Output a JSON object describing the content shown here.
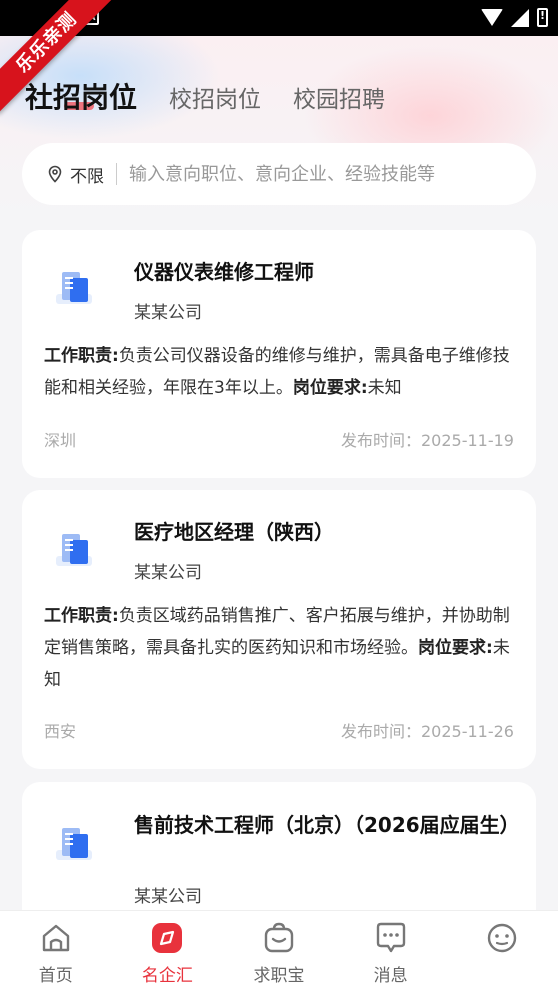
{
  "status_bar": {
    "app_indicator": "A"
  },
  "ribbon": {
    "text": "乐乐亲测"
  },
  "tabs": [
    {
      "label": "社招岗位",
      "active": true
    },
    {
      "label": "校招岗位",
      "active": false
    },
    {
      "label": "校园招聘",
      "active": false
    }
  ],
  "search": {
    "location": "不限",
    "placeholder": "输入意向职位、意向企业、经验技能等"
  },
  "jobs": [
    {
      "title": "仪器仪表维修工程师",
      "company": "某某公司",
      "duty_label": "工作职责:",
      "duty": "负责公司仪器设备的维修与维护，需具备电子维修技能和相关经验，年限在3年以上。",
      "req_label": "岗位要求:",
      "req": "未知",
      "city": "深圳",
      "date": "发布时间：2025-11-19"
    },
    {
      "title": "医疗地区经理（陕西）",
      "company": "某某公司",
      "duty_label": "工作职责:",
      "duty": "负责区域药品销售推广、客户拓展与维护，并协助制定销售策略，需具备扎实的医药知识和市场经验。",
      "req_label": "岗位要求:",
      "req": "未知",
      "city": "西安",
      "date": "发布时间：2025-11-26"
    },
    {
      "title": "售前技术工程师（北京）（2026届应届生）",
      "company": "某某公司"
    }
  ],
  "bottom_nav": [
    {
      "label": "首页",
      "icon": "home-icon",
      "active": false
    },
    {
      "label": "名企汇",
      "icon": "compass-icon",
      "active": true
    },
    {
      "label": "求职宝",
      "icon": "bag-icon",
      "active": false
    },
    {
      "label": "消息",
      "icon": "message-icon",
      "active": false
    },
    {
      "label": "",
      "icon": "profile-icon",
      "active": false
    }
  ],
  "colors": {
    "accent": "#e8323c",
    "brand_blue": "#2f6ef0"
  }
}
